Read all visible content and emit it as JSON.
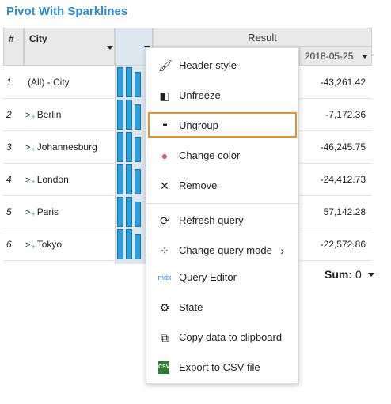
{
  "title": "Pivot With Sparklines",
  "header": {
    "num": "#",
    "city": "City",
    "result": "Result",
    "date": "2018-05-25"
  },
  "rows": [
    {
      "num": "1",
      "expand": "",
      "plus": "",
      "city": "(All) - City",
      "value": "-43,261.42"
    },
    {
      "num": "2",
      "expand": ">",
      "plus": "+",
      "city": "Berlin",
      "value": "-7,172.36"
    },
    {
      "num": "3",
      "expand": ">",
      "plus": "+",
      "city": "Johannesburg",
      "value": "-46,245.75"
    },
    {
      "num": "4",
      "expand": ">",
      "plus": "+",
      "city": "London",
      "value": "-24,412.73"
    },
    {
      "num": "5",
      "expand": ">",
      "plus": "+",
      "city": "Paris",
      "value": "57,142.28"
    },
    {
      "num": "6",
      "expand": ">",
      "plus": "+",
      "city": "Tokyo",
      "value": "-22,572.86"
    }
  ],
  "sum": {
    "label": "Sum:",
    "value": "0"
  },
  "menu": {
    "items": [
      {
        "label": "Header style",
        "icon": "paint-brush-icon",
        "glyph": "🖌"
      },
      {
        "label": "Unfreeze",
        "icon": "unfreeze-icon",
        "glyph": "◧"
      },
      {
        "label": "Ungroup",
        "icon": "ungroup-icon",
        "glyph": "▪▪"
      },
      {
        "label": "Change color",
        "icon": "color-circles-icon",
        "glyph": "●"
      },
      {
        "label": "Remove",
        "icon": "close-icon",
        "glyph": "✕"
      },
      {
        "label": "Refresh query",
        "icon": "refresh-icon",
        "glyph": "⟳"
      },
      {
        "label": "Change query mode",
        "icon": "query-mode-icon",
        "glyph": "⁘",
        "submenu": "›"
      },
      {
        "label": "Query Editor",
        "icon": "mdx-icon",
        "glyph": "mdx"
      },
      {
        "label": "State",
        "icon": "gear-icon",
        "glyph": "⚙"
      },
      {
        "label": "Copy data to clipboard",
        "icon": "copy-icon",
        "glyph": "⧉"
      },
      {
        "label": "Export to CSV file",
        "icon": "csv-file-icon",
        "glyph": "CSV"
      }
    ]
  },
  "colors": {
    "accent": "#2f8ad8",
    "sparkline_bar": "#2aa0dd",
    "highlight": "#f28f2c"
  }
}
